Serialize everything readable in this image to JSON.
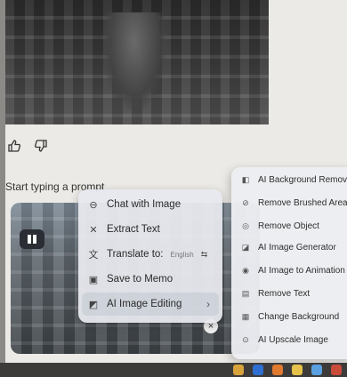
{
  "prompt": {
    "placeholder": "Start typing a prompt"
  },
  "feedback": {
    "like_icon": "thumbs-up-icon",
    "dislike_icon": "thumbs-down-icon"
  },
  "context_menu": {
    "items": [
      {
        "label": "Chat with Image",
        "icon": "chat-icon"
      },
      {
        "label": "Extract Text",
        "icon": "extract-icon"
      },
      {
        "label": "Translate to:",
        "icon": "translate-icon",
        "language": "English",
        "swap": "⇆"
      },
      {
        "label": "Save to Memo",
        "icon": "memo-icon"
      },
      {
        "label": "AI Image Editing",
        "icon": "edit-image-icon",
        "chevron": "›"
      }
    ]
  },
  "submenu": {
    "items": [
      {
        "label": "AI Background Remov",
        "icon": "background-remove-icon"
      },
      {
        "label": "Remove Brushed Area",
        "icon": "brush-icon"
      },
      {
        "label": "Remove Object",
        "icon": "remove-object-icon"
      },
      {
        "label": "AI Image Generator",
        "icon": "image-generator-icon"
      },
      {
        "label": "AI Image to Animation",
        "icon": "animation-icon"
      },
      {
        "label": "Remove Text",
        "icon": "remove-text-icon"
      },
      {
        "label": "Change Background",
        "icon": "change-background-icon"
      },
      {
        "label": "AI Upscale Image",
        "icon": "upscale-icon"
      }
    ]
  },
  "thumbnail": {
    "close": "×"
  }
}
